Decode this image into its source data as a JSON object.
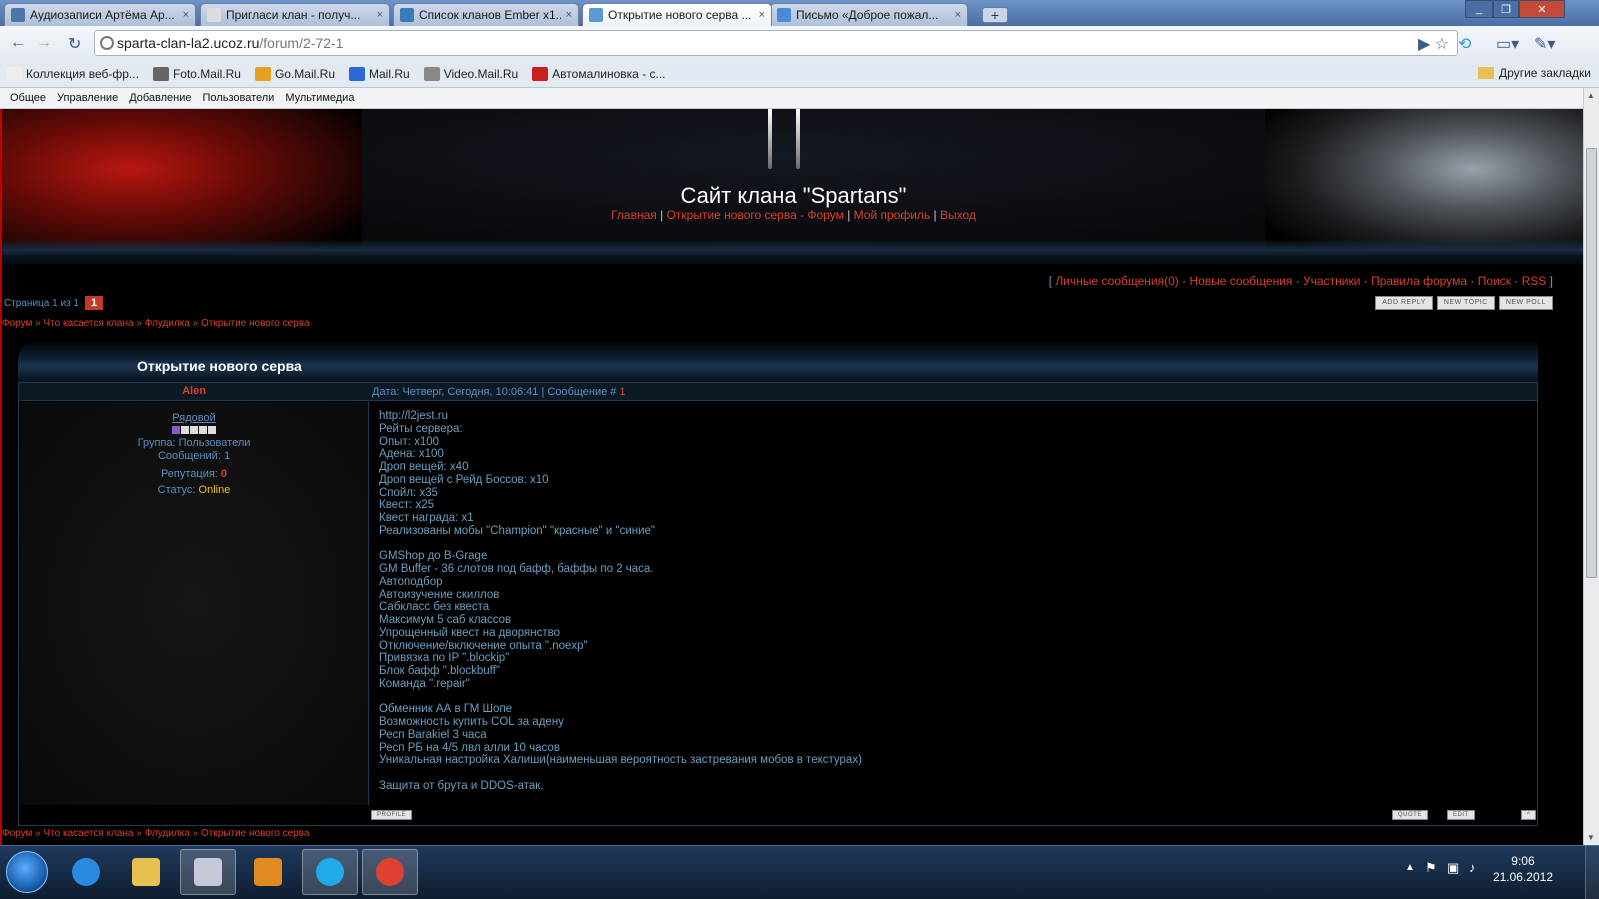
{
  "browser": {
    "tabs": [
      {
        "label": "Аудиозаписи Артёма Ар...",
        "favicon_color": "#4a76a8"
      },
      {
        "label": "Пригласи клан - получ...",
        "favicon_color": "#dddddd"
      },
      {
        "label": "Список кланов Ember x1...",
        "favicon_color": "#3a7ab8"
      },
      {
        "label": "Открытие нового серва ...",
        "favicon_color": "#5a9ad0"
      },
      {
        "label": "Письмо «Доброе пожал...",
        "favicon_color": "#4a8ad8"
      }
    ],
    "new_tab": "+",
    "close_glyph": "×",
    "url_host": "sparta-clan-la2.ucoz.ru",
    "url_path": "/forum/2-72-1",
    "bookmarks": [
      {
        "label": "Коллекция веб-фр...",
        "icon_color": "#eeeeee"
      },
      {
        "label": "Foto.Mail.Ru",
        "icon_color": "#666666"
      },
      {
        "label": "Go.Mail.Ru",
        "icon_color": "#e8a020"
      },
      {
        "label": "Mail.Ru",
        "icon_color": "#2a6ad8"
      },
      {
        "label": "Video.Mail.Ru",
        "icon_color": "#888888"
      },
      {
        "label": "Автомалиновка - с...",
        "icon_color": "#c82020"
      }
    ],
    "other_bookmarks": "Другие закладки"
  },
  "ucoz_bar": [
    "Общее",
    "Управление",
    "Добавление",
    "Пользователи",
    "Мультимедиа"
  ],
  "site": {
    "title": "Сайт клана \"Spartans\"",
    "nav": [
      "Главная",
      "Открытие нового серва - Форум",
      "Мой профиль",
      "Выход"
    ],
    "nav_sep": " | "
  },
  "forum_links": {
    "open": "[",
    "items": [
      "Личные сообщения(0)",
      "Новые сообщения",
      "Участники",
      "Правила форума",
      "Поиск",
      "RSS"
    ],
    "sep": " · ",
    "close": "]"
  },
  "pager": {
    "label": "Страница 1 из 1",
    "current": "1"
  },
  "action_buttons": [
    "ADD REPLY",
    "NEW TOPIC",
    "NEW POLL"
  ],
  "breadcrumbs": [
    "Форум",
    "Что касается клана",
    "Флудилка",
    "Открытие нового серва"
  ],
  "crumb_sep": " » ",
  "topic_title": "Открытие нового серва",
  "post": {
    "author": "Alen",
    "date_label": "Дата: Четверг, Сегодня, 10:06:41 | Сообщение # ",
    "message_number": "1",
    "rank": "Рядовой",
    "rank_stars_filled": 1,
    "rank_stars_total": 5,
    "group": "Группа: Пользователи",
    "messages": "Сообщений: 1",
    "reputation_label": "Репутация: ",
    "reputation_value": "0",
    "status_label": "Статус: ",
    "status_value": "Online",
    "body": "http://l2jest.ru\nРейты сервера:\nОпыт: x100\nАдена: x100\nДроп вещей: x40\nДроп вещей с Рейд Боссов: x10\nСпойл: x35\nКвест: x25\nКвест награда: x1\nРеализованы мобы \"Champion\" \"красные\" и \"синие\"\n\nGMShop до B-Grage\nGM Buffer - 36 слотов под бафф, баффы по 2 часа.\nАвтоподбор\nАвтоизучение скиллов\nСабкласс без квеста\nМаксимум 5 саб классов\nУпрощенный квест на дворянство\nОтключение/включение опыта \".noexp\"\nПривязка по IP \".blockip\"\nБлок бафф \".blockbuff\"\nКоманда \".repair\"\n\nОбменник АА в ГМ Шопе\nВозможность купить COL за адену\nРесп Barakiel 3 часа\nРесп РБ на 4/5 лвл алли 10 часов\nУникальная настройка Халиши(наименьшая вероятность застревания мобов в текстурах)\n\nЗащита от брута и DDOS-атак.",
    "profile_button": "PROFILE",
    "quote_button": "QUOTE",
    "edit_button": "EDIT",
    "up_button": "^"
  },
  "taskbar": {
    "time": "9:06",
    "date": "21.06.2012",
    "apps": [
      {
        "name": "internet-explorer-icon",
        "color": "#2a8ae0"
      },
      {
        "name": "explorer-folder-icon",
        "color": "#e8c050"
      },
      {
        "name": "paint-icon",
        "color": "#c8c8d8"
      },
      {
        "name": "media-player-icon",
        "color": "#e08a20"
      },
      {
        "name": "skype-icon",
        "color": "#20a8e8"
      },
      {
        "name": "chrome-icon",
        "color": "#e04030"
      }
    ]
  }
}
